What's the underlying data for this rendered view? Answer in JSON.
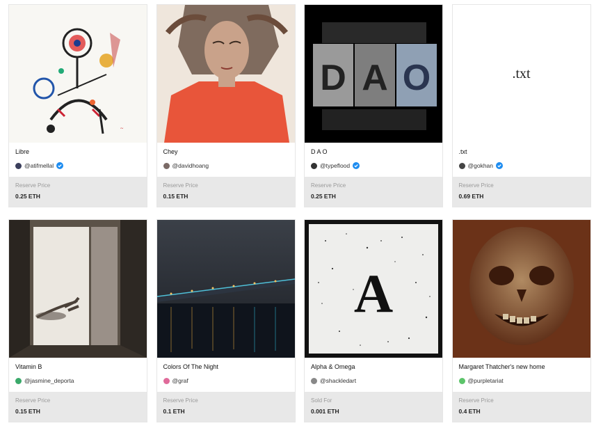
{
  "cards": [
    {
      "title": "Libre",
      "creator": "@atifmellal",
      "verified": true,
      "avatar_color": "#3b3f5c",
      "price_label": "Reserve Price",
      "price": "0.25 ETH"
    },
    {
      "title": "Chey",
      "creator": "@davidhoang",
      "verified": false,
      "avatar_color": "#7a6a66",
      "price_label": "Reserve Price",
      "price": "0.15 ETH"
    },
    {
      "title": "D A O",
      "creator": "@typeflood",
      "verified": true,
      "avatar_color": "#333333",
      "price_label": "Reserve Price",
      "price": "0.25 ETH"
    },
    {
      "title": ".txt",
      "creator": "@gokhan",
      "verified": true,
      "avatar_color": "#444444",
      "art_text": ".txt",
      "price_label": "Reserve Price",
      "price": "0.69 ETH"
    },
    {
      "title": "Vitamin B",
      "creator": "@jasmine_deporta",
      "verified": false,
      "avatar_color": "#3aa96a",
      "price_label": "Reserve Price",
      "price": "0.15 ETH"
    },
    {
      "title": "Colors Of The Night",
      "creator": "@graf",
      "verified": false,
      "avatar_color": "#e06a9a",
      "price_label": "Reserve Price",
      "price": "0.1 ETH"
    },
    {
      "title": "Alpha & Omega",
      "creator": "@shackledart",
      "verified": false,
      "avatar_color": "#888888",
      "art_text": "A",
      "price_label": "Sold For",
      "price": "0.001 ETH"
    },
    {
      "title": "Margaret Thatcher's new home",
      "creator": "@purpletariat",
      "verified": false,
      "avatar_color": "#5cc46a",
      "price_label": "Reserve Price",
      "price": "0.4 ETH"
    }
  ],
  "colors": {
    "verified_badge": "#1d8cf0",
    "price_panel": "#e8e8e8"
  }
}
